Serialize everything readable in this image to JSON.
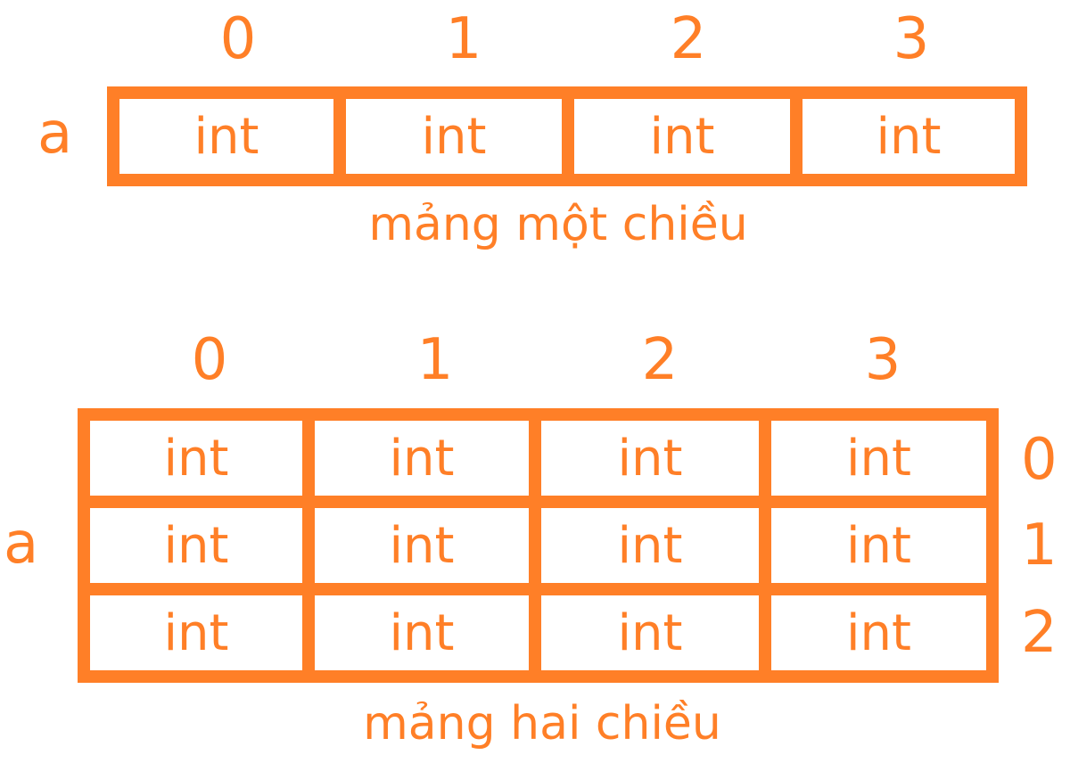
{
  "accent_color": "#ff7f27",
  "one_dim": {
    "variable": "a",
    "column_indices": [
      "0",
      "1",
      "2",
      "3"
    ],
    "cells": [
      "int",
      "int",
      "int",
      "int"
    ],
    "caption": "mảng một chiều"
  },
  "two_dim": {
    "variable": "a",
    "column_indices": [
      "0",
      "1",
      "2",
      "3"
    ],
    "row_indices": [
      "0",
      "1",
      "2"
    ],
    "rows": [
      [
        "int",
        "int",
        "int",
        "int"
      ],
      [
        "int",
        "int",
        "int",
        "int"
      ],
      [
        "int",
        "int",
        "int",
        "int"
      ]
    ],
    "caption": "mảng hai chiều"
  }
}
